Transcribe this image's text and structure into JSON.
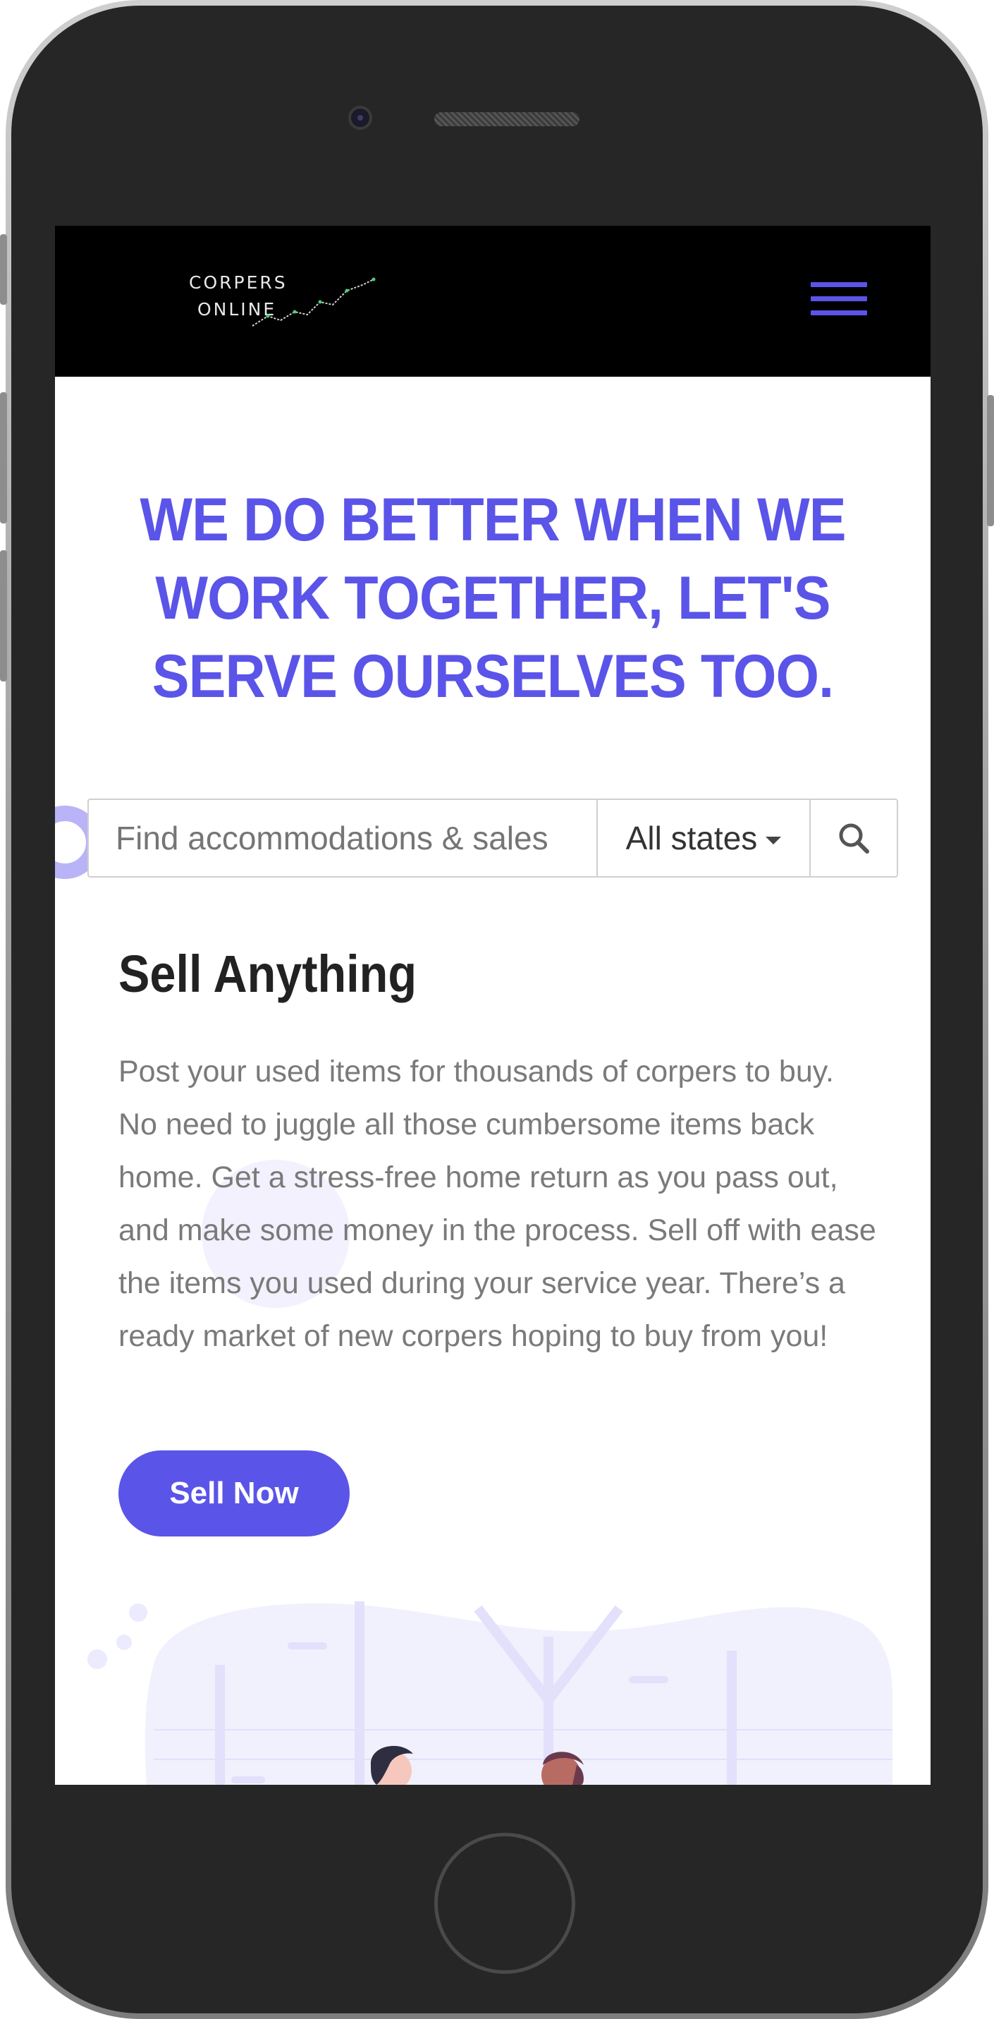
{
  "nav": {
    "logo_line1": "CORPERS",
    "logo_line2": "ONLINE",
    "menu_icon": "hamburger-menu-icon"
  },
  "hero": {
    "title": "WE DO BETTER WHEN WE WORK TOGETHER, LET'S SERVE OURSELVES TOO."
  },
  "search": {
    "placeholder": "Find accommodations & sales",
    "state_selected": "All states",
    "search_icon": "search-icon"
  },
  "section": {
    "title": "Sell Anything",
    "body": "Post your used items for thousands of corpers to buy. No need to juggle all those cumbersome items back home. Get a stress-free home return as you pass out, and make some money in the process. Sell off with ease the items you used during your service year. There’s a ready market of new corpers hoping to buy from you!",
    "button_label": "Sell Now"
  },
  "colors": {
    "accent": "#5b54e8",
    "navbar": "#000000",
    "body_text": "#7a7a7a",
    "heading_text": "#222222"
  }
}
